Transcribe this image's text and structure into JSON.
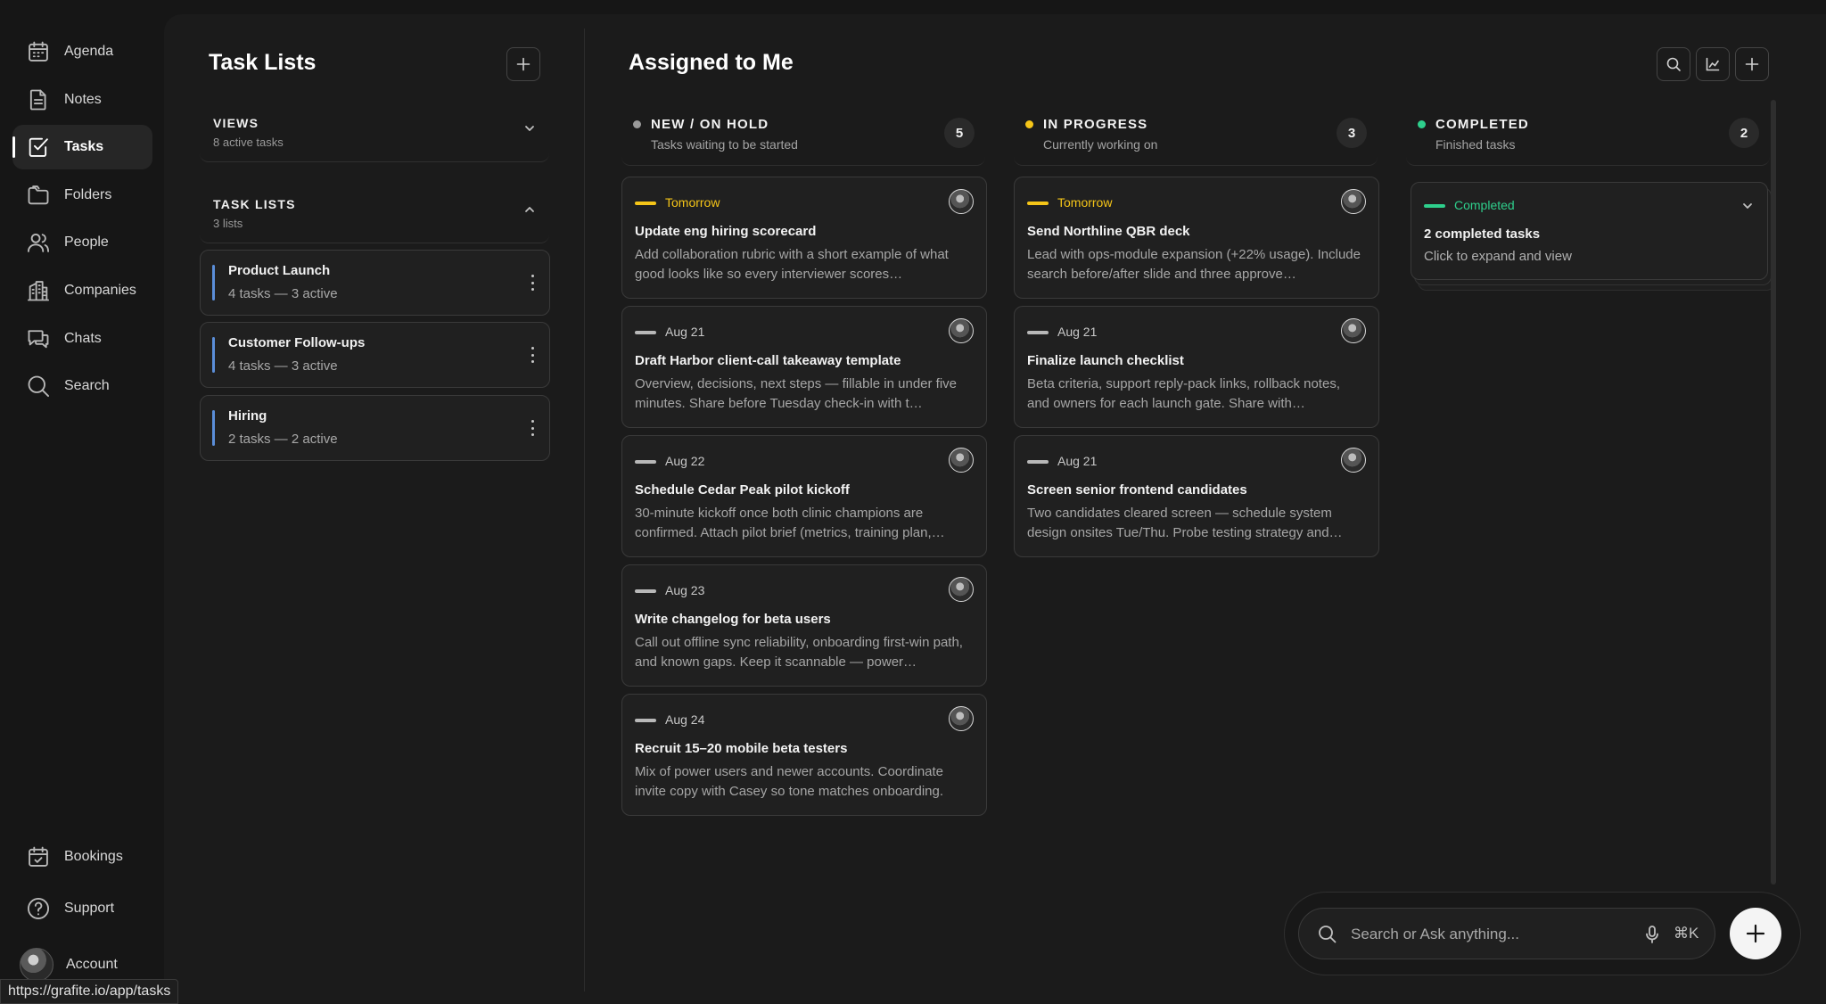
{
  "nav": {
    "items": [
      {
        "label": "Agenda",
        "icon": "calendar-icon"
      },
      {
        "label": "Notes",
        "icon": "note-icon"
      },
      {
        "label": "Tasks",
        "icon": "checkbox-icon"
      },
      {
        "label": "Folders",
        "icon": "folder-icon"
      },
      {
        "label": "People",
        "icon": "people-icon"
      },
      {
        "label": "Companies",
        "icon": "building-icon"
      },
      {
        "label": "Chats",
        "icon": "chat-icon"
      },
      {
        "label": "Search",
        "icon": "search-icon"
      }
    ],
    "bottom": [
      {
        "label": "Bookings",
        "icon": "calendar-check-icon"
      },
      {
        "label": "Support",
        "icon": "help-icon"
      }
    ],
    "account_label": "Account",
    "active": "Tasks"
  },
  "status_url": "https://grafite.io/app/tasks",
  "task_lists": {
    "title": "Task Lists",
    "views": {
      "title": "VIEWS",
      "subtitle": "8 active tasks"
    },
    "lists_section": {
      "title": "TASK LISTS",
      "subtitle": "3 lists"
    },
    "lists": [
      {
        "name": "Product Launch",
        "meta": "4 tasks — 3 active"
      },
      {
        "name": "Customer Follow-ups",
        "meta": "4 tasks — 3 active"
      },
      {
        "name": "Hiring",
        "meta": "2 tasks — 2 active"
      }
    ],
    "accent_color": "#5b8ed8"
  },
  "board": {
    "title": "Assigned to Me",
    "columns": [
      {
        "title": "NEW / ON HOLD",
        "subtitle": "Tasks waiting to be started",
        "count": "5",
        "dot_color": "#9a9a9a",
        "tasks": [
          {
            "due": "Tomorrow",
            "due_color": "#f5c518",
            "title": "Update eng hiring scorecard",
            "desc": "Add collaboration rubric with a short example of what good looks like so every interviewer scores…"
          },
          {
            "due": "Aug 21",
            "due_color": "#b8b8b8",
            "title": "Draft Harbor client-call takeaway template",
            "desc": "Overview, decisions, next steps — fillable in under five minutes. Share before Tuesday check-in with t…"
          },
          {
            "due": "Aug 22",
            "due_color": "#b8b8b8",
            "title": "Schedule Cedar Peak pilot kickoff",
            "desc": "30-minute kickoff once both clinic champions are confirmed. Attach pilot brief (metrics, training plan,…"
          },
          {
            "due": "Aug 23",
            "due_color": "#b8b8b8",
            "title": "Write changelog for beta users",
            "desc": "Call out offline sync reliability, onboarding first-win path, and known gaps. Keep it scannable — power…"
          },
          {
            "due": "Aug 24",
            "due_color": "#b8b8b8",
            "title": "Recruit 15–20 mobile beta testers",
            "desc": "Mix of power users and newer accounts. Coordinate invite copy with Casey so tone matches onboarding."
          }
        ]
      },
      {
        "title": "IN PROGRESS",
        "subtitle": "Currently working on",
        "count": "3",
        "dot_color": "#f5c518",
        "tasks": [
          {
            "due": "Tomorrow",
            "due_color": "#f5c518",
            "title": "Send Northline QBR deck",
            "desc": "Lead with ops-module expansion (+22% usage). Include search before/after slide and three approve…"
          },
          {
            "due": "Aug 21",
            "due_color": "#b8b8b8",
            "title": "Finalize launch checklist",
            "desc": "Beta criteria, support reply-pack links, rollback notes, and owners for each launch gate. Share with…"
          },
          {
            "due": "Aug 21",
            "due_color": "#b8b8b8",
            "title": "Screen senior frontend candidates",
            "desc": "Two candidates cleared screen — schedule system design onsites Tue/Thu. Probe testing strategy and…"
          }
        ]
      },
      {
        "title": "COMPLETED",
        "subtitle": "Finished tasks",
        "count": "2",
        "dot_color": "#2ecf8c",
        "summary": {
          "label": "Completed",
          "title": "2 completed tasks",
          "subtitle": "Click to expand and view"
        }
      }
    ]
  },
  "assistant": {
    "placeholder": "Search or Ask anything...",
    "shortcut": "⌘K"
  }
}
